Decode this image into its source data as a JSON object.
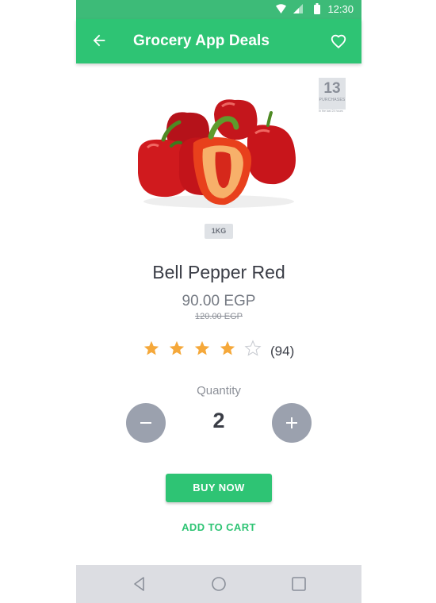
{
  "status_bar": {
    "time": "12:30"
  },
  "app_bar": {
    "title": "Grocery App Deals"
  },
  "product": {
    "name": "Bell Pepper Red",
    "price": "90.00 EGP",
    "old_price": "120.00 EGP",
    "weight": "1KG",
    "purchases_count": "13",
    "purchases_label": "PURCHASES",
    "purchases_sub": "In the last 24 hours"
  },
  "rating": {
    "value": 4,
    "max": 5,
    "reviews": "(94)"
  },
  "quantity": {
    "label": "Quantity",
    "value": "2"
  },
  "actions": {
    "buy_now": "BUY NOW",
    "add_to_cart": "ADD TO CART"
  },
  "colors": {
    "primary": "#2ec474",
    "status": "#3dbb78",
    "star": "#f5a83a",
    "button_gray": "#9ba1ae"
  },
  "icons": [
    "back-arrow-icon",
    "heart-outline-icon",
    "wifi-icon",
    "signal-icon",
    "battery-icon",
    "star-icon",
    "minus-icon",
    "plus-icon",
    "nav-back-icon",
    "nav-home-icon",
    "nav-recents-icon"
  ]
}
